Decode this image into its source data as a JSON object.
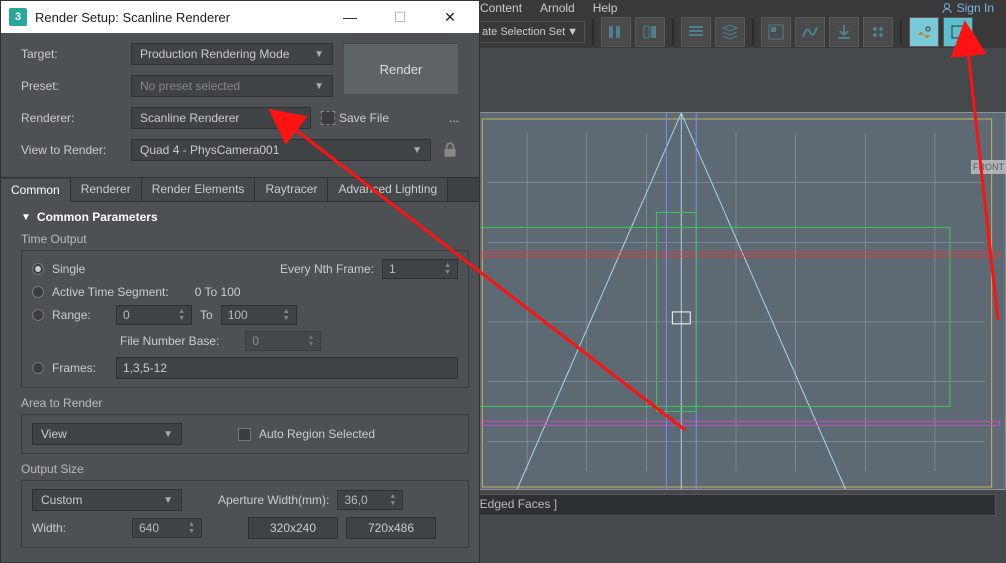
{
  "topmenu": {
    "items": [
      "Content",
      "Arnold",
      "Help"
    ],
    "signin": "Sign In",
    "selection_set": "ate Selection Set"
  },
  "dialog": {
    "title": "Render Setup: Scanline Renderer",
    "target_label": "Target:",
    "target_value": "Production Rendering Mode",
    "preset_label": "Preset:",
    "preset_value": "No preset selected",
    "renderer_label": "Renderer:",
    "renderer_value": "Scanline Renderer",
    "view_label": "View to Render:",
    "view_value": "Quad 4 - PhysCamera001",
    "render_btn": "Render",
    "savefile": "Save File",
    "ellipsis": "...",
    "tabs": [
      "Common",
      "Renderer",
      "Render Elements",
      "Raytracer",
      "Advanced Lighting"
    ],
    "rollout": "Common Parameters",
    "time_output": {
      "header": "Time Output",
      "single": "Single",
      "every_nth": "Every Nth Frame:",
      "every_nth_val": "1",
      "active": "Active Time Segment:",
      "active_range": "0 To 100",
      "range": "Range:",
      "range_from": "0",
      "range_to_lbl": "To",
      "range_to": "100",
      "fnb": "File Number Base:",
      "fnb_val": "0",
      "frames": "Frames:",
      "frames_val": "1,3,5-12"
    },
    "area": {
      "header": "Area to Render",
      "value": "View",
      "auto": "Auto Region Selected"
    },
    "output": {
      "header": "Output Size",
      "custom": "Custom",
      "aperture_lbl": "Aperture Width(mm):",
      "aperture_val": "36,0",
      "width_lbl": "Width:",
      "width_val": "640",
      "preset1": "320x240",
      "preset2": "720x486"
    }
  },
  "viewport": {
    "panel_title": "[ Edged Faces ]",
    "front": "FRONT"
  },
  "toolbar_icons": [
    "measure",
    "align",
    "layers",
    "list",
    "stack",
    "window",
    "wave",
    "download",
    "gear",
    "teapot",
    "panel"
  ]
}
